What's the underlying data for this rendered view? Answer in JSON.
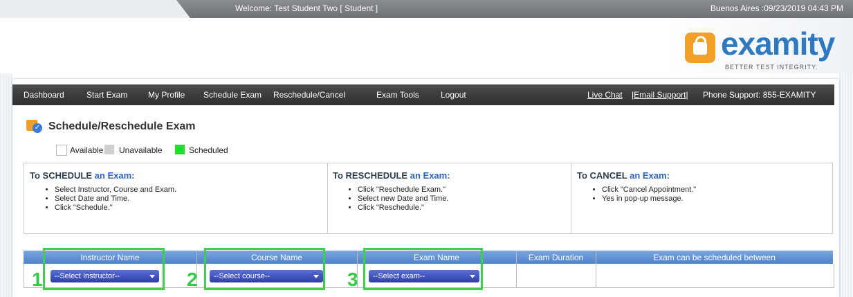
{
  "topbar": {
    "welcome": "Welcome: Test Student Two [ Student ]",
    "timezone": "Buenos Aires :09/23/2019 04:43 PM"
  },
  "logo": {
    "name": "examity",
    "tagline": "BETTER TEST INTEGRITY."
  },
  "nav": {
    "items": [
      "Dashboard",
      "Start Exam",
      "My Profile",
      "Schedule Exam",
      "Reschedule/Cancel",
      "Exam Tools",
      "Logout"
    ],
    "live_chat": "Live Chat",
    "email_support": "|Email Support|",
    "phone_support": "Phone Support: 855-EXAMITY"
  },
  "page": {
    "title": "Schedule/Reschedule Exam"
  },
  "legend": {
    "available": "Available",
    "unavailable": "Unavailable",
    "scheduled": "Scheduled"
  },
  "instructions": {
    "schedule": {
      "title_prefix": "To SCHEDULE",
      "title_suffix": "an Exam:",
      "items": [
        "Select Instructor, Course and Exam.",
        "Select Date and Time.",
        "Click \"Schedule.\""
      ]
    },
    "reschedule": {
      "title_prefix": "To RESCHEDULE",
      "title_suffix": "an Exam:",
      "items": [
        "Click \"Reschedule Exam.\"",
        "Select new Date and Time.",
        "Click \"Reschedule.\""
      ]
    },
    "cancel": {
      "title_prefix": "To CANCEL",
      "title_suffix": "an Exam:",
      "items": [
        "Click \"Cancel Appointment.\"",
        "Yes in pop-up message."
      ]
    }
  },
  "table": {
    "headers": [
      "Instructor Name",
      "Course Name",
      "Exam Name",
      "Exam Duration",
      "Exam can be scheduled between"
    ],
    "selects": {
      "instructor": "--Select Instructor--",
      "course": "--Select course--",
      "exam": "--Select exam--"
    },
    "steps": [
      "1",
      "2",
      "3"
    ]
  },
  "colors": {
    "accent_blue": "#2a62c9",
    "highlight_green": "#3bd14a",
    "brand_orange": "#f0a029"
  }
}
